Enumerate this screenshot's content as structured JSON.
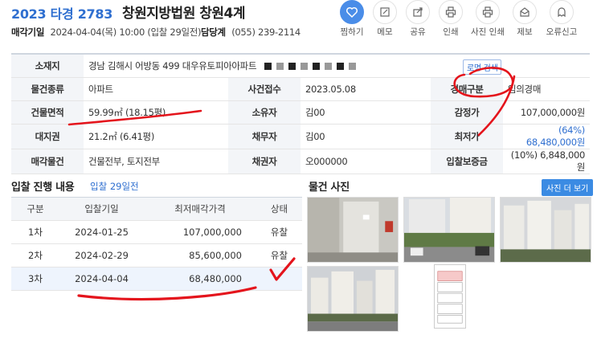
{
  "header": {
    "case_no": "2023 타경 2783",
    "court": "창원지방법원 창원4계",
    "sale_date_label": "매각기일",
    "sale_date_value": "2024-04-04(목) 10:00 (입찰 29일전)",
    "dept_label": "담당계",
    "dept_value": "(055) 239-2114"
  },
  "actions": [
    {
      "label": "찜하기",
      "icon": "heart-icon"
    },
    {
      "label": "메모",
      "icon": "memo-icon"
    },
    {
      "label": "공유",
      "icon": "share-icon"
    },
    {
      "label": "인쇄",
      "icon": "print-icon"
    },
    {
      "label": "사진 인쇄",
      "icon": "photo-print-icon"
    },
    {
      "label": "제보",
      "icon": "report-icon"
    },
    {
      "label": "오류신고",
      "icon": "error-report-icon"
    }
  ],
  "info": {
    "address_label": "소재지",
    "address_value": "경남 김해시 어방동 499 대우유토피아아파트",
    "map_search": "로명 검색",
    "type_label": "물건종류",
    "type_value": "아파트",
    "received_label": "사건접수",
    "received_value": "2023.05.08",
    "auction_kind_label": "경매구분",
    "auction_kind_value": "임의경매",
    "area_label": "건물면적",
    "area_value": "59.99㎡ (18.15평)",
    "owner_label": "소유자",
    "owner_value": "김00",
    "appraisal_label": "감정가",
    "appraisal_value": "107,000,000원",
    "land_label": "대지권",
    "land_value": "21.2㎡ (6.41평)",
    "debtor_label": "채무자",
    "debtor_value": "김00",
    "min_price_label": "최저가",
    "min_price_value": "(64%) 68,480,000원",
    "sale_item_label": "매각물건",
    "sale_item_value": "건물전부, 토지전부",
    "creditor_label": "채권자",
    "creditor_value": "오000000",
    "deposit_label": "입찰보증금",
    "deposit_value": "(10%) 6,848,000원"
  },
  "bidding": {
    "title": "입찰 진행 내용",
    "note": "입찰 29일전",
    "columns": [
      "구분",
      "입찰기일",
      "최저매각가격",
      "상태"
    ],
    "rows": [
      {
        "round": "1차",
        "date": "2024-01-25",
        "price": "107,000,000",
        "status": "유찰"
      },
      {
        "round": "2차",
        "date": "2024-02-29",
        "price": "85,600,000",
        "status": "유찰"
      },
      {
        "round": "3차",
        "date": "2024-04-04",
        "price": "68,480,000",
        "status": ""
      }
    ]
  },
  "photos": {
    "title": "물건 사진",
    "more_button": "사진 더 보기"
  }
}
